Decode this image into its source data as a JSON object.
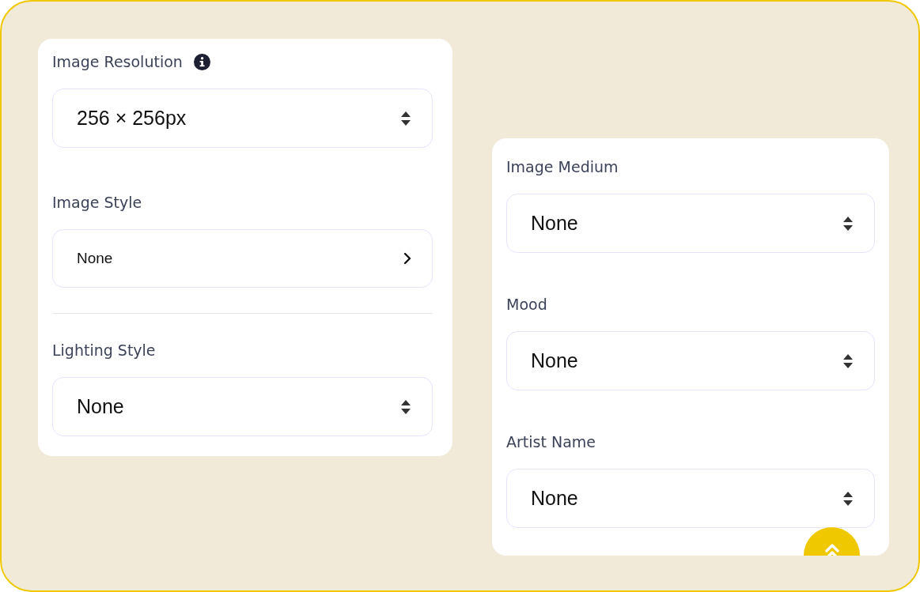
{
  "panels": [
    {
      "fields": [
        {
          "label": "Image Resolution",
          "info": true,
          "kind": "select",
          "value": "256 × 256px"
        },
        {
          "label": "Image Style",
          "kind": "picker",
          "value": "None"
        },
        {
          "label": "Lighting Style",
          "divider_before": true,
          "kind": "select",
          "value": "None"
        }
      ]
    },
    {
      "fields": [
        {
          "label": "Image Medium",
          "kind": "select",
          "value": "None"
        },
        {
          "label": "Mood",
          "kind": "select",
          "value": "None"
        },
        {
          "label": "Artist Name",
          "kind": "select",
          "value": "None"
        }
      ],
      "scroll_top_button": true
    }
  ]
}
